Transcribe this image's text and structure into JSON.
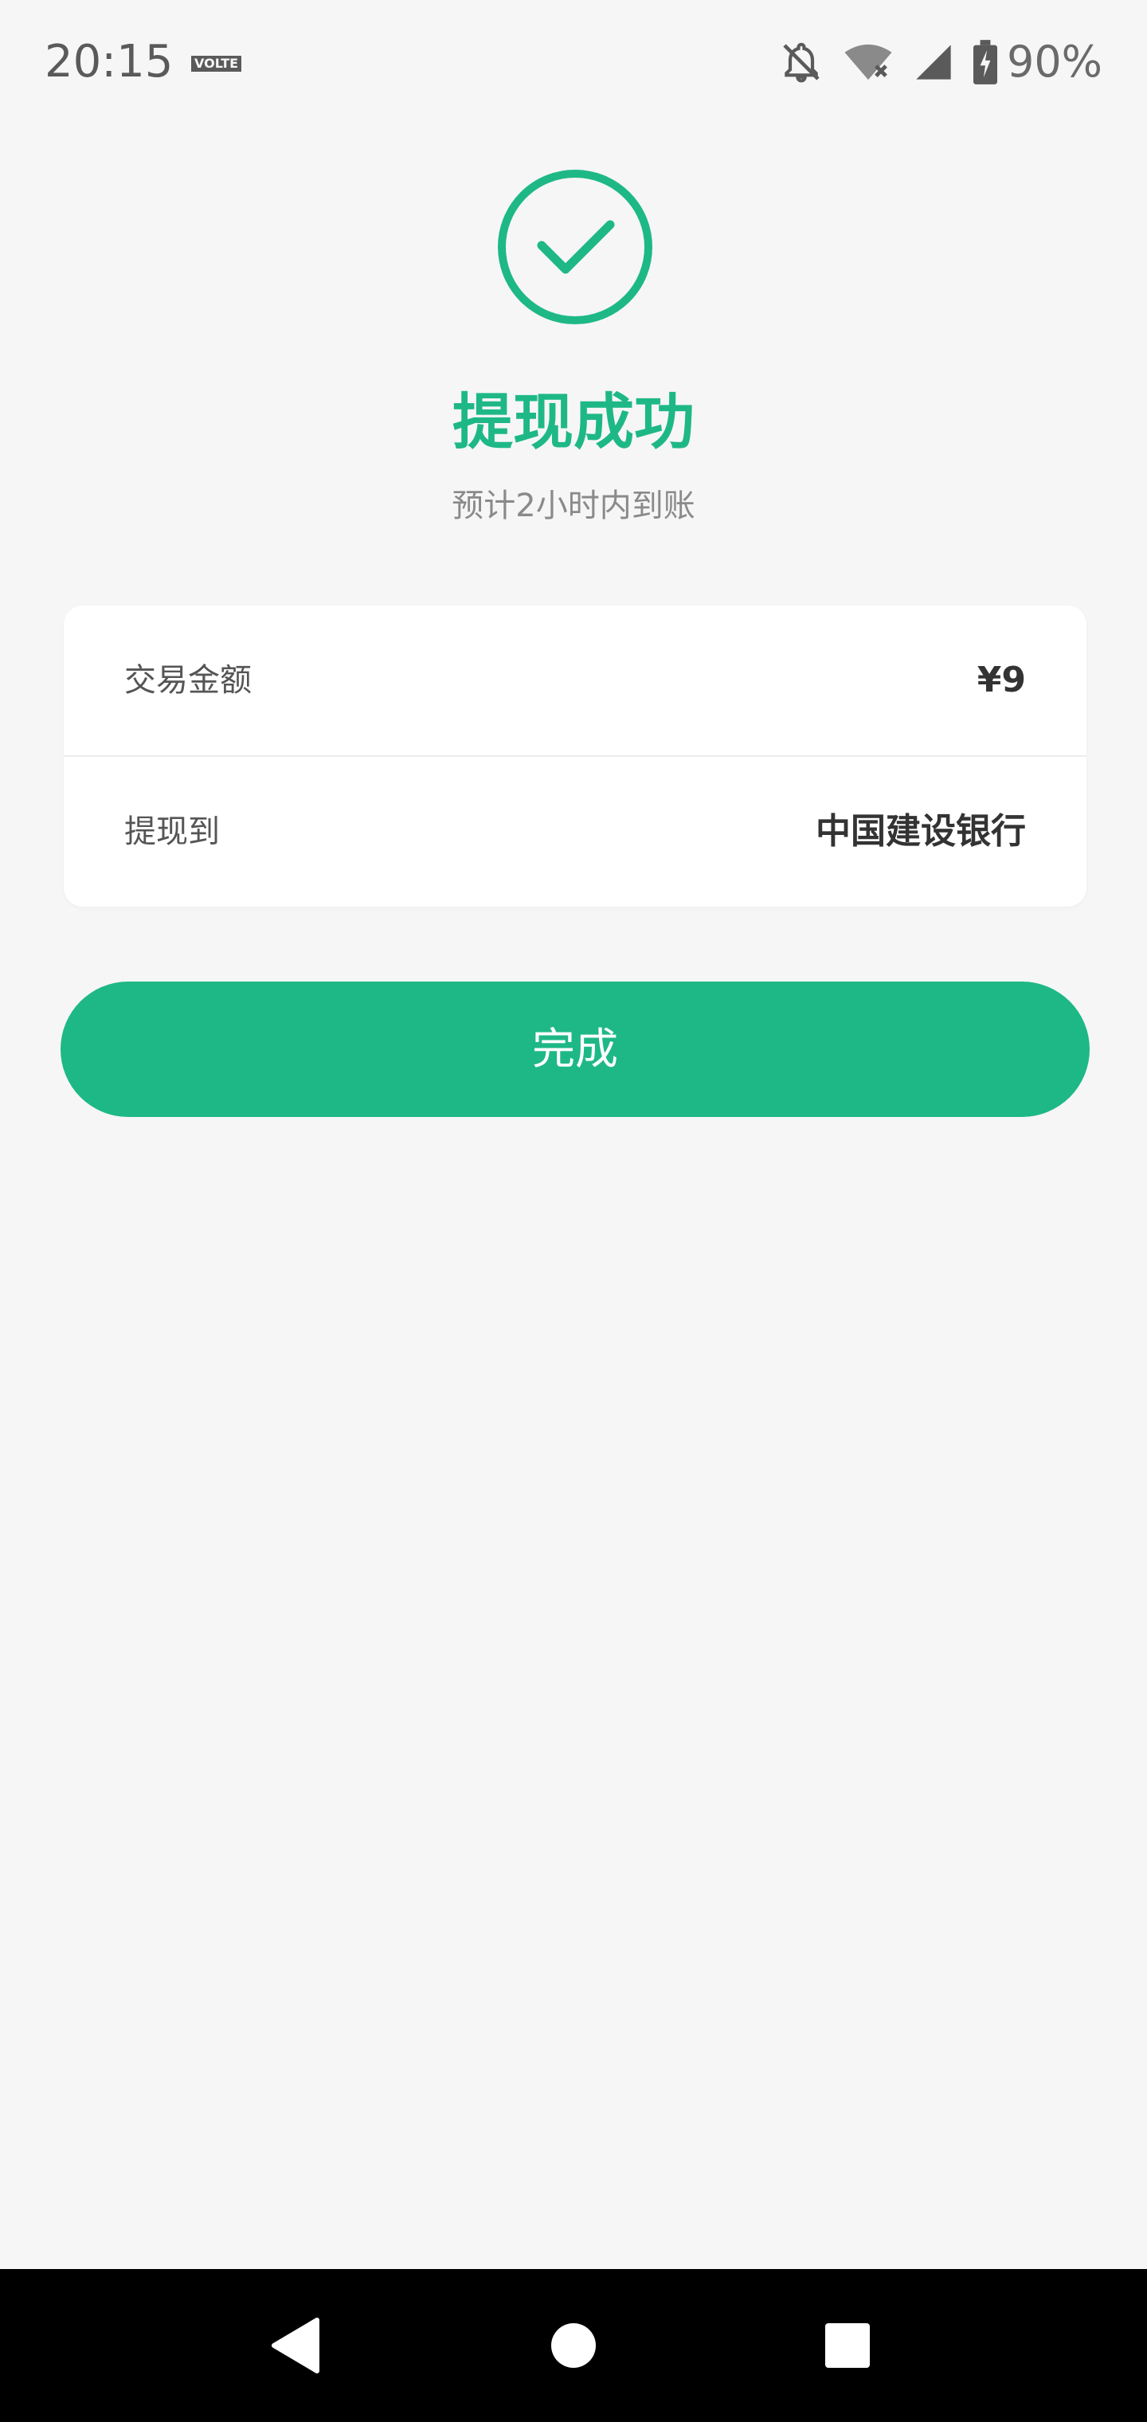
{
  "status_bar": {
    "time": "20:15",
    "volte": "VOLTE",
    "battery": "90%",
    "icons": [
      "notifications-off-icon",
      "wifi-off-icon",
      "cell-signal-icon",
      "battery-charging-icon"
    ]
  },
  "result": {
    "icon": "check-circle-icon",
    "title": "提现成功",
    "subtitle": "预计2小时内到账",
    "accent_color": "#1eb886"
  },
  "details": {
    "amount_label": "交易金额",
    "amount_value": "¥9",
    "destination_label": "提现到",
    "destination_value": "中国建设银行"
  },
  "actions": {
    "done_label": "完成"
  },
  "nav_bar": {
    "icons": [
      "back-icon",
      "home-icon",
      "recents-icon"
    ]
  }
}
